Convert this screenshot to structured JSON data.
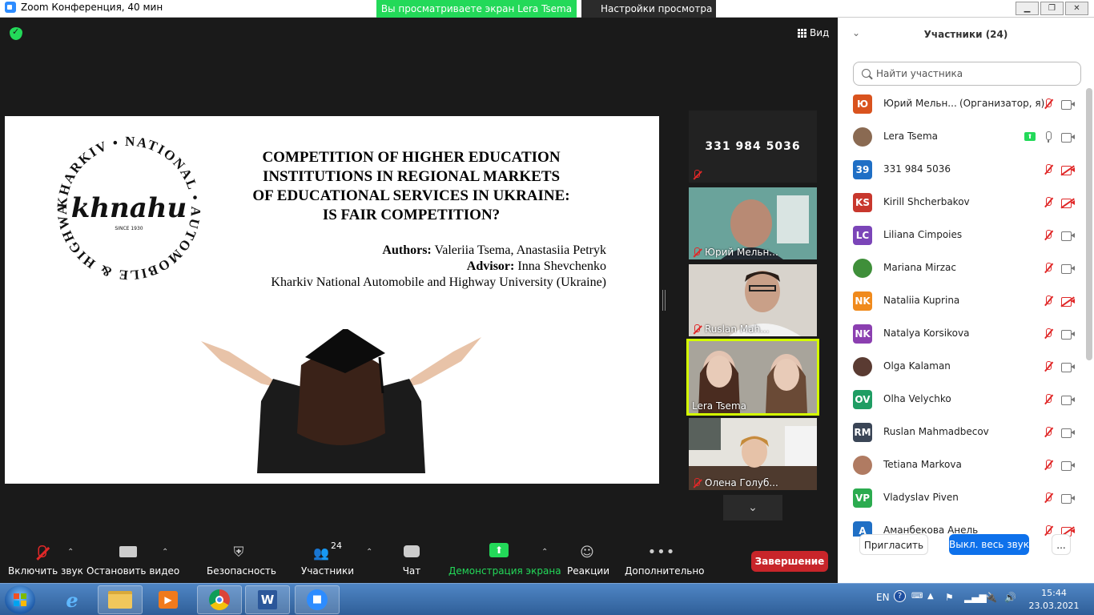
{
  "window": {
    "title": "Zoom Конференция, 40 мин",
    "sharing_banner": "Вы просматриваете экран Lera Tsema",
    "view_options": "Настройки просмотра",
    "view_button": "Вид"
  },
  "slide": {
    "logo_text": "khnahu",
    "logo_since": "SINCE 1930",
    "logo_ring_text": "KHARKIV • NATIONAL • AUTOMOBILE & HIGHWAY • UNIVERSITY •",
    "title_lines": [
      "COMPETITION OF HIGHER EDUCATION",
      "INSTITUTIONS IN REGIONAL MARKETS",
      "OF EDUCATIONAL SERVICES IN UKRAINE:",
      "IS FAIR COMPETITION?"
    ],
    "authors_label": "Authors:",
    "authors": "Valeriia Tsema, Anastasiia Petryk",
    "advisor_label": "Advisor:",
    "advisor": "Inna Shevchenko",
    "university": "Kharkiv National Automobile and Highway University (Ukraine)"
  },
  "thumbnails": [
    {
      "kind": "number",
      "label": "331 984 5036",
      "muted": true
    },
    {
      "kind": "video",
      "label": "Юрий Мельн...",
      "muted": true
    },
    {
      "kind": "video",
      "label": "Ruslan Mah...",
      "muted": true
    },
    {
      "kind": "video",
      "label": "Lera Tsema",
      "muted": false,
      "active": true
    },
    {
      "kind": "video",
      "label": "Олена Голуб...",
      "muted": true
    }
  ],
  "toolbar": {
    "unmute": "Включить звук",
    "stop_video": "Остановить видео",
    "security": "Безопасность",
    "participants": "Участники",
    "participants_count": "24",
    "chat": "Чат",
    "share_screen": "Демонстрация экрана",
    "reactions": "Реакции",
    "more": "Дополнительно",
    "end": "Завершение"
  },
  "panel": {
    "title": "Участники (24)",
    "search_placeholder": "Найти участника",
    "invite": "Пригласить",
    "mute_all": "Выкл. весь звук",
    "more": "...",
    "participants": [
      {
        "initials": "Ю",
        "name": "Юрий Мельн...",
        "note": "(Организатор, я)",
        "color": "#d9531e",
        "mic": "off",
        "cam": "on"
      },
      {
        "initials": "",
        "name": "Lera Tsema",
        "note": "",
        "color": "#8a6a52",
        "mic": "on",
        "cam": "on",
        "sharing": true,
        "photo": true
      },
      {
        "initials": "39",
        "name": "331 984 5036",
        "note": "",
        "color": "#1f6fc5",
        "mic": "off",
        "cam": "off"
      },
      {
        "initials": "KS",
        "name": "Kirill Shcherbakov",
        "note": "",
        "color": "#c8372d",
        "mic": "off",
        "cam": "off"
      },
      {
        "initials": "LC",
        "name": "Liliana Cimpoies",
        "note": "",
        "color": "#7b45b8",
        "mic": "off",
        "cam": "on"
      },
      {
        "initials": "",
        "name": "Mariana Mirzac",
        "note": "",
        "color": "#3f8f3a",
        "mic": "off",
        "cam": "on",
        "photo": true
      },
      {
        "initials": "NK",
        "name": "Nataliia Kuprina",
        "note": "",
        "color": "#f08a1c",
        "mic": "off",
        "cam": "off"
      },
      {
        "initials": "NK",
        "name": "Natalya Korsikova",
        "note": "",
        "color": "#8b3fb0",
        "mic": "off",
        "cam": "on"
      },
      {
        "initials": "",
        "name": "Olga Kalaman",
        "note": "",
        "color": "#5a3b32",
        "mic": "off",
        "cam": "on",
        "photo": true
      },
      {
        "initials": "OV",
        "name": "Olha Velychko",
        "note": "",
        "color": "#1f9d63",
        "mic": "off",
        "cam": "on"
      },
      {
        "initials": "RM",
        "name": "Ruslan Mahmadbecov",
        "note": "",
        "color": "#3a4556",
        "mic": "off",
        "cam": "on"
      },
      {
        "initials": "",
        "name": "Tetiana Markova",
        "note": "",
        "color": "#b07b62",
        "mic": "off",
        "cam": "on",
        "photo": true
      },
      {
        "initials": "VP",
        "name": "Vladyslav Piven",
        "note": "",
        "color": "#2bab4f",
        "mic": "off",
        "cam": "on"
      },
      {
        "initials": "A",
        "name": "Аманбекова Анель",
        "note": "",
        "color": "#1f6fc5",
        "mic": "off",
        "cam": "off"
      }
    ]
  },
  "taskbar": {
    "lang": "EN",
    "time": "15:44",
    "date": "23.03.2021"
  },
  "colors": {
    "accent_green": "#23d959",
    "end_red": "#c8252a",
    "mute_all_blue": "#0e71eb",
    "muted_red": "#e02828",
    "active_speaker": "#d4ff00"
  }
}
